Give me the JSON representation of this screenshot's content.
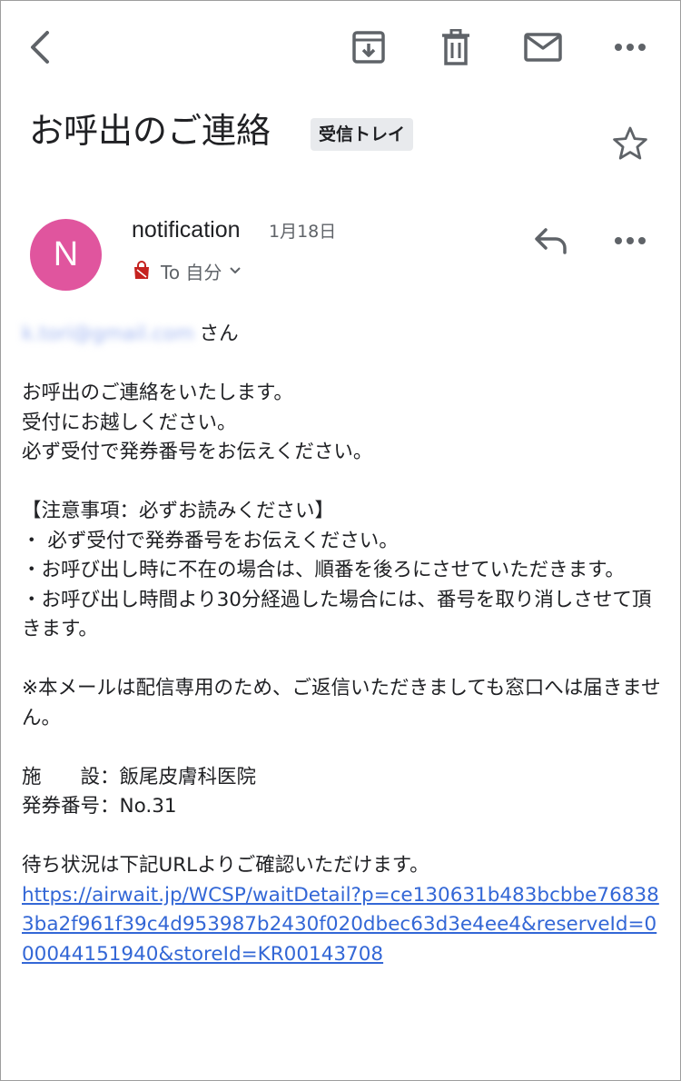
{
  "toolbar": {
    "back_icon": "back-arrow-icon",
    "archive_icon": "archive-icon",
    "delete_icon": "trash-icon",
    "mark_unread_icon": "mail-icon",
    "more_icon": "more-horizontal-icon"
  },
  "subject": {
    "title": "お呼出のご連絡",
    "label": "受信トレイ"
  },
  "sender": {
    "avatar_letter": "N",
    "avatar_color": "#e0559e",
    "name": "notification",
    "date": "1月18日",
    "recipient": "To 自分"
  },
  "body": {
    "greeting_email": "k.tori@gmail.com",
    "greeting_suffix": "さん",
    "intro": [
      "お呼出のご連絡をいたします。",
      "受付にお越しください。",
      "必ず受付で発券番号をお伝えください。"
    ],
    "notice_heading": "【注意事項：必ずお読みください】",
    "notices": [
      "・ 必ず受付で発券番号をお伝えください。",
      "・お呼び出し時に不在の場合は、順番を後ろにさせていただきます。",
      "・お呼び出し時間より30分経過した場合には、番号を取り消しさせて頂きます。"
    ],
    "disclaimer": "※本メールは配信専用のため、ご返信いただきましても窓口へは届きません。",
    "facility": "施　　設：飯尾皮膚科医院",
    "ticket": "発券番号：No.31",
    "status_text": "待ち状況は下記URLよりご確認いただけます。",
    "url": "https://airwait.jp/WCSP/waitDetail?p=ce130631b483bcbbe768383ba2f961f39c4d953987b2430f020dbec63d3e4ee4&reserveId=000044151940&storeId=KR00143708"
  }
}
